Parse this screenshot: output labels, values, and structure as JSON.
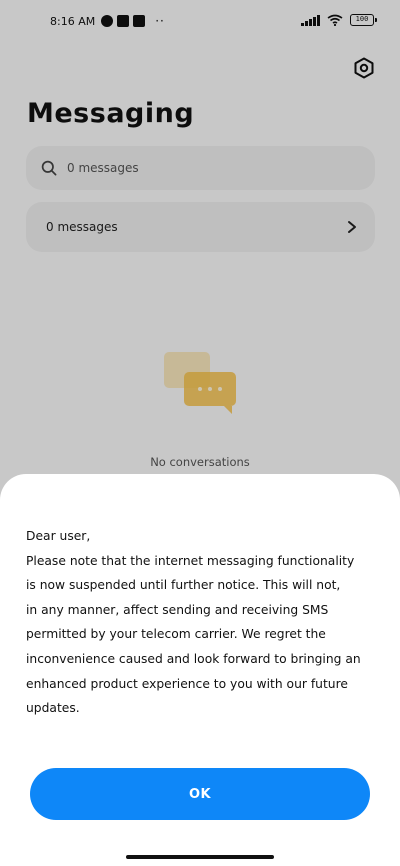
{
  "status_bar": {
    "time": "8:16 AM",
    "dots": "··",
    "battery": "100",
    "icons": [
      "notification-app-icon",
      "notification-square-icon",
      "notification-upload-icon",
      "signal-icon",
      "wifi-icon",
      "battery-icon"
    ]
  },
  "header": {
    "title": "Messaging",
    "settings_icon": "settings-hexagon-icon"
  },
  "search": {
    "placeholder": "0 messages",
    "icon": "search-icon"
  },
  "messages_row": {
    "label": "0 messages",
    "icon": "chevron-right-icon"
  },
  "empty_state": {
    "text": "No conversations",
    "icon": "conversation-bubbles-icon"
  },
  "dialog": {
    "lines": [
      "Dear user,",
      "Please note that the internet messaging functionality",
      "is now suspended until further notice. This will not,",
      "in any manner, affect sending and receiving SMS",
      "permitted by your telecom carrier. We regret the",
      "inconvenience caused and look forward to bringing an",
      "enhanced product experience to you with our future",
      "updates."
    ],
    "ok_label": "OK"
  },
  "colors": {
    "primary": "#0e87f8",
    "background": "#fafafa",
    "card": "#efefef",
    "illustration": "#f7c24b"
  }
}
